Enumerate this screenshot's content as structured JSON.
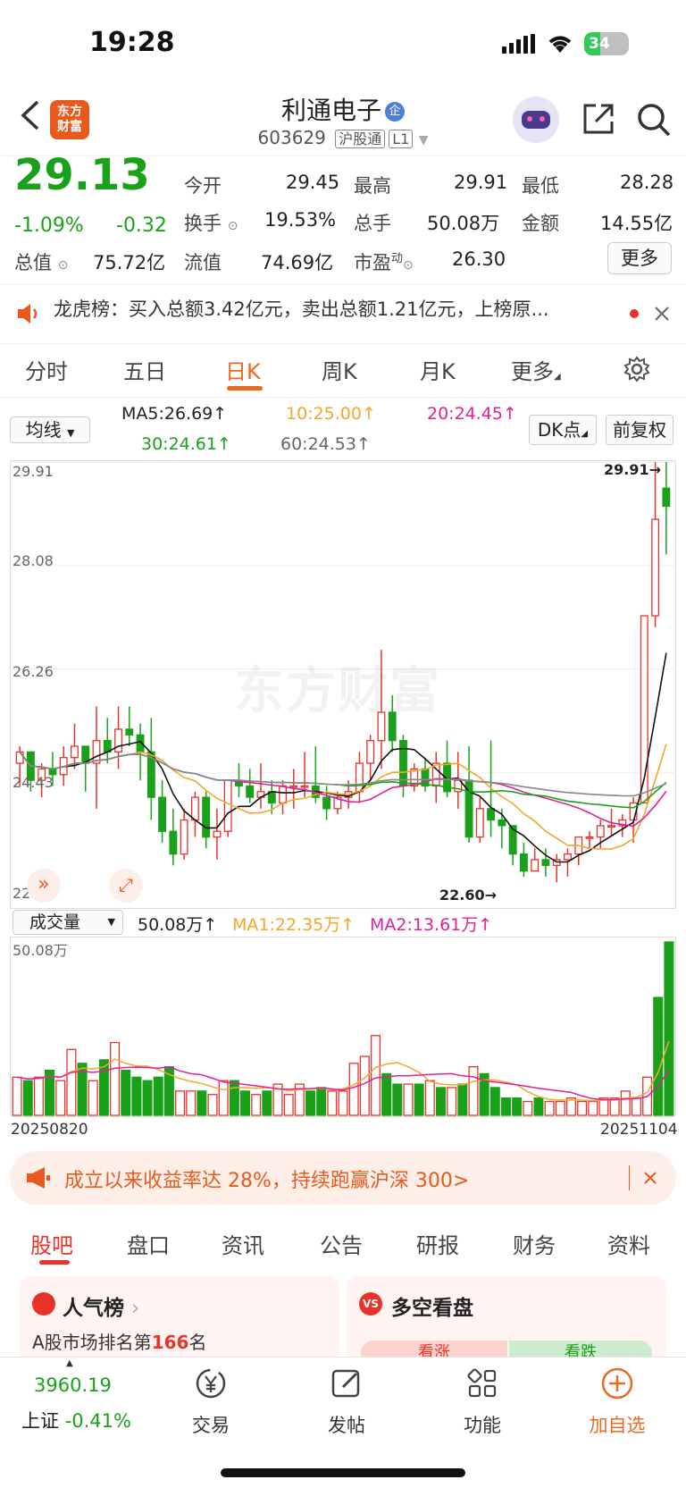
{
  "status": {
    "time": "19:28",
    "battery": "34"
  },
  "header": {
    "logo_line1": "东方",
    "logo_line2": "财富",
    "title": "利通电子",
    "badge": "企",
    "code": "603629",
    "tag1": "沪股通",
    "tag2": "L1"
  },
  "quote": {
    "price": "29.13",
    "pct": "-1.09%",
    "chg": "-0.32",
    "open_label": "今开",
    "open": "29.45",
    "high_label": "最高",
    "high": "29.91",
    "low_label": "最低",
    "low": "28.28",
    "turnover_label": "换手",
    "turnover": "19.53%",
    "vol_label": "总手",
    "vol": "50.08万",
    "amount_label": "金额",
    "amount": "14.55亿",
    "mktcap_label": "总值",
    "mktcap": "75.72亿",
    "float_label": "流值",
    "float": "74.69亿",
    "pe_label": "市盈",
    "pe_sup": "动",
    "pe": "26.30",
    "more": "更多"
  },
  "notice": {
    "text": "龙虎榜：买入总额3.42亿元，卖出总额1.21亿元，上榜原..."
  },
  "ktabs": [
    "分时",
    "五日",
    "日K",
    "周K",
    "月K",
    "更多"
  ],
  "ma": {
    "select": "均线",
    "ma5": "MA5:26.69↑",
    "ma10": "10:25.00↑",
    "ma20": "20:24.45↑",
    "ma30": "30:24.61↑",
    "ma60": "60:24.53↑",
    "dk": "DK点",
    "fq": "前复权"
  },
  "kaxis": {
    "y1": "29.91",
    "y2": "28.08",
    "y3": "26.26",
    "y4": "24.43",
    "y5": "22.60",
    "hi_mark": "29.91→",
    "lo_mark": "22.60→",
    "watermark": "东方财富"
  },
  "volume": {
    "select": "成交量",
    "v": "50.08万↑",
    "ma1": "MA1:22.35万↑",
    "ma2": "MA2:13.61万↑",
    "ymax": "50.08万",
    "date_start": "20250820",
    "date_end": "20251104"
  },
  "banner": {
    "text": "成立以来收益率达 28%，持续跑赢沪深 300>"
  },
  "btabs": [
    "股吧",
    "盘口",
    "资讯",
    "公告",
    "研报",
    "财务",
    "资料"
  ],
  "cards": {
    "left_title": "人气榜",
    "left_sub_pre": "A股市场排名第",
    "left_rank": "166",
    "left_sub_post": "名",
    "right_title": "多空看盘",
    "up": "看涨",
    "down": "看跌"
  },
  "nav": {
    "index_value": "3960.19",
    "index_name": "上证",
    "index_pct": "-0.41%",
    "trade": "交易",
    "post": "发帖",
    "func": "功能",
    "add": "加自选"
  },
  "colors": {
    "up": "#e8322a",
    "down": "#1aa11a",
    "accent": "#ea6b1e"
  },
  "chart_data": {
    "type": "candlestick",
    "y_range": [
      22.6,
      29.91
    ],
    "ohlc": [
      [
        24.6,
        24.9,
        24.2,
        24.8
      ],
      [
        24.8,
        24.7,
        24.1,
        24.3
      ],
      [
        24.3,
        24.6,
        24.0,
        24.5
      ],
      [
        24.5,
        24.8,
        24.2,
        24.4
      ],
      [
        24.4,
        24.9,
        24.2,
        24.7
      ],
      [
        24.7,
        25.3,
        24.5,
        24.9
      ],
      [
        24.9,
        24.9,
        24.1,
        24.6
      ],
      [
        24.6,
        25.6,
        23.8,
        25.0
      ],
      [
        25.0,
        25.4,
        24.6,
        24.8
      ],
      [
        24.8,
        25.6,
        24.5,
        25.2
      ],
      [
        25.2,
        25.6,
        24.9,
        25.1
      ],
      [
        25.1,
        25.3,
        24.3,
        24.8
      ],
      [
        24.8,
        25.4,
        23.6,
        24.0
      ],
      [
        24.0,
        24.3,
        23.2,
        23.4
      ],
      [
        23.4,
        23.8,
        22.8,
        23.0
      ],
      [
        23.0,
        23.8,
        22.9,
        23.6
      ],
      [
        23.6,
        24.1,
        23.3,
        24.0
      ],
      [
        24.0,
        24.1,
        23.1,
        23.3
      ],
      [
        23.3,
        23.8,
        22.9,
        23.4
      ],
      [
        23.4,
        24.3,
        23.3,
        24.3
      ],
      [
        24.3,
        24.6,
        24.0,
        24.2
      ],
      [
        24.2,
        24.5,
        23.9,
        24.0
      ],
      [
        24.0,
        24.6,
        23.8,
        24.1
      ],
      [
        24.1,
        24.3,
        23.7,
        23.9
      ],
      [
        23.9,
        24.3,
        23.7,
        24.2
      ],
      [
        24.2,
        24.5,
        23.8,
        24.2
      ],
      [
        24.2,
        24.8,
        24.0,
        24.2
      ],
      [
        24.2,
        24.9,
        23.9,
        24.0
      ],
      [
        24.0,
        24.2,
        23.6,
        23.8
      ],
      [
        23.8,
        24.1,
        23.7,
        24.0
      ],
      [
        24.0,
        24.3,
        23.8,
        24.1
      ],
      [
        24.1,
        24.8,
        23.9,
        24.6
      ],
      [
        24.6,
        25.1,
        24.3,
        25.0
      ],
      [
        25.0,
        26.6,
        24.5,
        25.5
      ],
      [
        25.5,
        25.8,
        24.8,
        25.0
      ],
      [
        25.0,
        25.1,
        24.0,
        24.2
      ],
      [
        24.2,
        24.6,
        24.1,
        24.5
      ],
      [
        24.5,
        24.7,
        24.1,
        24.2
      ],
      [
        24.2,
        24.8,
        23.9,
        24.6
      ],
      [
        24.6,
        25.0,
        24.0,
        24.1
      ],
      [
        24.1,
        24.8,
        23.8,
        24.3
      ],
      [
        24.3,
        24.9,
        23.2,
        23.3
      ],
      [
        23.3,
        24.0,
        23.2,
        23.8
      ],
      [
        23.8,
        25.0,
        23.3,
        23.6
      ],
      [
        23.6,
        23.8,
        23.1,
        23.5
      ],
      [
        23.5,
        23.5,
        22.8,
        23.0
      ],
      [
        23.0,
        23.2,
        22.6,
        22.7
      ],
      [
        22.7,
        23.1,
        22.7,
        22.9
      ],
      [
        22.9,
        23.1,
        22.6,
        22.8
      ],
      [
        22.8,
        23.0,
        22.5,
        22.9
      ],
      [
        22.9,
        23.1,
        22.6,
        23.0
      ],
      [
        23.0,
        23.2,
        22.8,
        23.3
      ],
      [
        23.3,
        23.4,
        23.1,
        23.3
      ],
      [
        23.3,
        23.6,
        23.1,
        23.5
      ],
      [
        23.5,
        23.8,
        23.3,
        23.5
      ],
      [
        23.5,
        23.7,
        23.3,
        23.6
      ],
      [
        23.6,
        24.0,
        23.2,
        23.9
      ],
      [
        23.9,
        27.2,
        23.9,
        27.2
      ],
      [
        27.2,
        29.91,
        27.0,
        28.9
      ],
      [
        29.45,
        29.91,
        28.28,
        29.13
      ]
    ],
    "volume_max": "50.08万",
    "volumes": [
      11,
      10,
      11,
      13,
      10,
      19,
      15,
      10,
      16,
      21,
      13,
      11,
      10,
      11,
      14,
      7,
      7,
      7,
      6,
      10,
      10,
      7,
      6,
      7,
      9,
      6,
      9,
      7,
      8,
      7,
      7,
      15,
      17,
      23,
      12,
      9,
      9,
      9,
      10,
      8,
      8,
      9,
      14,
      12,
      8,
      5,
      5,
      4,
      5,
      4,
      4,
      5,
      4,
      4,
      5,
      5,
      7,
      5,
      11,
      34,
      50
    ]
  }
}
